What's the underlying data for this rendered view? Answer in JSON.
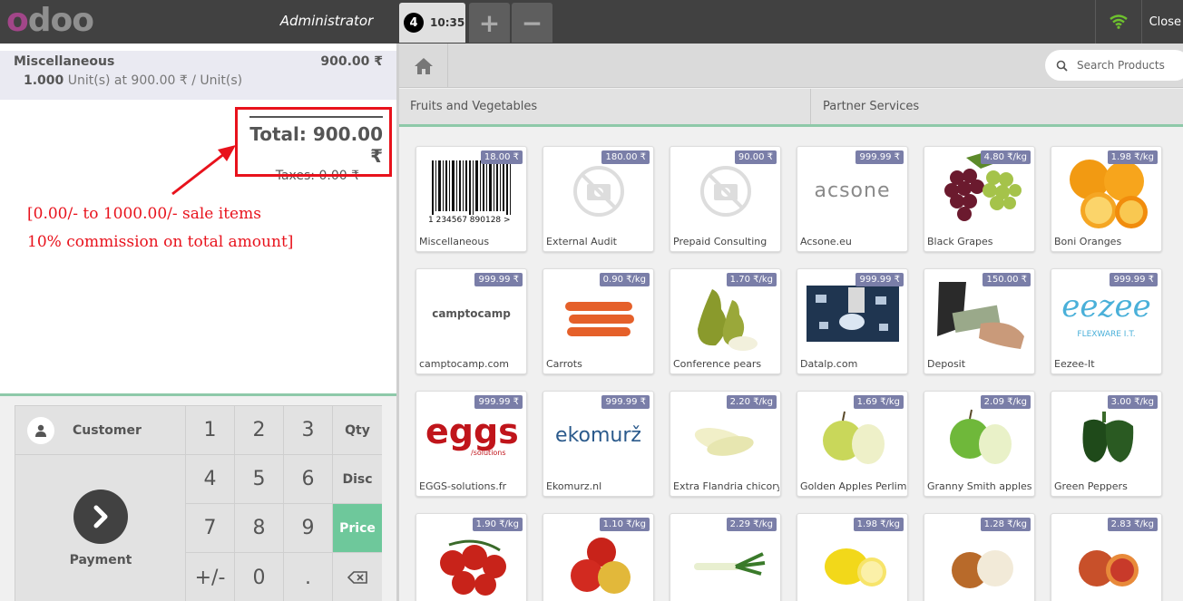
{
  "topbar": {
    "logo": "odoo",
    "cashier": "Administrator",
    "order": {
      "number": "4",
      "time": "10:35"
    },
    "new_order": "+",
    "delete_order": "−",
    "close": "Close"
  },
  "order": {
    "line": {
      "product": "Miscellaneous",
      "price": "900.00 ₹",
      "qty": "1.000",
      "detail": "Unit(s) at 900.00 ₹ / Unit(s)"
    },
    "total": "Total: 900.00 ₹",
    "taxes": "Taxes: 0.00 ₹"
  },
  "annotation": {
    "line1": "[0.00/- to 1000.00/- sale items",
    "line2": "10% commission on total amount]",
    "color": "#e8121c"
  },
  "controls": {
    "customer": "Customer",
    "payment": "Payment",
    "keys": [
      "1",
      "2",
      "3",
      "4",
      "5",
      "6",
      "7",
      "8",
      "9",
      "+/-",
      "0",
      "."
    ],
    "modes": [
      "Qty",
      "Disc",
      "Price"
    ],
    "selected_mode": "Price"
  },
  "search": {
    "placeholder": "Search Products"
  },
  "categories": [
    "Fruits and Vegetables",
    "Partner Services"
  ],
  "products": [
    {
      "name": "Miscellaneous",
      "price": "18.00 ₹",
      "icon": "barcode"
    },
    {
      "name": "External Audit",
      "price": "180.00 ₹",
      "icon": "no-image"
    },
    {
      "name": "Prepaid Consulting",
      "price": "90.00 ₹",
      "icon": "no-image"
    },
    {
      "name": "Acsone.eu",
      "price": "999.99 ₹",
      "icon": "acsone-logo",
      "logo_text": "acsone"
    },
    {
      "name": "Black Grapes",
      "price": "4.80 ₹/kg",
      "icon": "grapes"
    },
    {
      "name": "Boni Oranges",
      "price": "1.98 ₹/kg",
      "icon": "oranges"
    },
    {
      "name": "camptocamp.com",
      "price": "999.99 ₹",
      "icon": "camptocamp-logo",
      "logo_text": "camptocamp"
    },
    {
      "name": "Carrots",
      "price": "0.90 ₹/kg",
      "icon": "carrots"
    },
    {
      "name": "Conference pears",
      "price": "1.70 ₹/kg",
      "icon": "pears"
    },
    {
      "name": "Datalp.com",
      "price": "999.99 ₹",
      "icon": "datalp-image"
    },
    {
      "name": "Deposit",
      "price": "150.00 ₹",
      "icon": "money"
    },
    {
      "name": "Eezee-It",
      "price": "999.99 ₹",
      "icon": "eezee-logo",
      "logo_text": "eezee",
      "logo_sub": "FLEXWARE I.T."
    },
    {
      "name": "EGGS-solutions.fr",
      "price": "999.99 ₹",
      "icon": "eggs-logo",
      "logo_text": "eggs",
      "logo_sub": "/solutions"
    },
    {
      "name": "Ekomurz.nl",
      "price": "999.99 ₹",
      "icon": "ekomurz-logo",
      "logo_text": "ekomurž"
    },
    {
      "name": "Extra Flandria chicory",
      "price": "2.20 ₹/kg",
      "icon": "chicory"
    },
    {
      "name": "Golden Apples Perlim",
      "price": "1.69 ₹/kg",
      "icon": "golden-apples"
    },
    {
      "name": "Granny Smith apples",
      "price": "2.09 ₹/kg",
      "icon": "green-apples"
    },
    {
      "name": "Green Peppers",
      "price": "3.00 ₹/kg",
      "icon": "peppers"
    },
    {
      "name": "",
      "price": "1.90 ₹/kg",
      "icon": "tomatoes"
    },
    {
      "name": "",
      "price": "1.10 ₹/kg",
      "icon": "red-apples"
    },
    {
      "name": "",
      "price": "2.29 ₹/kg",
      "icon": "leeks"
    },
    {
      "name": "",
      "price": "1.98 ₹/kg",
      "icon": "lemons"
    },
    {
      "name": "",
      "price": "1.28 ₹/kg",
      "icon": "onions"
    },
    {
      "name": "",
      "price": "2.83 ₹/kg",
      "icon": "blood-oranges"
    }
  ],
  "colors": {
    "topbar": "#414141",
    "accent_green": "#6ec89b",
    "price_tag": "#7a7ea8",
    "logo_purple": "#a24689"
  }
}
